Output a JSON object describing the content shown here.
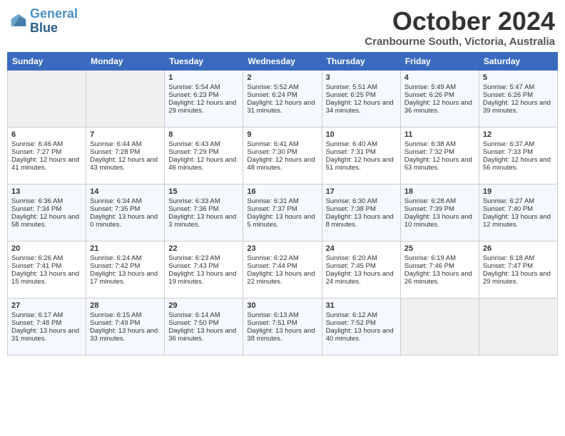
{
  "header": {
    "logo_line1": "General",
    "logo_line2": "Blue",
    "month_title": "October 2024",
    "subtitle": "Cranbourne South, Victoria, Australia"
  },
  "weekdays": [
    "Sunday",
    "Monday",
    "Tuesday",
    "Wednesday",
    "Thursday",
    "Friday",
    "Saturday"
  ],
  "weeks": [
    [
      {
        "day": "",
        "sunrise": "",
        "sunset": "",
        "daylight": ""
      },
      {
        "day": "",
        "sunrise": "",
        "sunset": "",
        "daylight": ""
      },
      {
        "day": "1",
        "sunrise": "Sunrise: 5:54 AM",
        "sunset": "Sunset: 6:23 PM",
        "daylight": "Daylight: 12 hours and 29 minutes."
      },
      {
        "day": "2",
        "sunrise": "Sunrise: 5:52 AM",
        "sunset": "Sunset: 6:24 PM",
        "daylight": "Daylight: 12 hours and 31 minutes."
      },
      {
        "day": "3",
        "sunrise": "Sunrise: 5:51 AM",
        "sunset": "Sunset: 6:25 PM",
        "daylight": "Daylight: 12 hours and 34 minutes."
      },
      {
        "day": "4",
        "sunrise": "Sunrise: 5:49 AM",
        "sunset": "Sunset: 6:26 PM",
        "daylight": "Daylight: 12 hours and 36 minutes."
      },
      {
        "day": "5",
        "sunrise": "Sunrise: 5:47 AM",
        "sunset": "Sunset: 6:26 PM",
        "daylight": "Daylight: 12 hours and 39 minutes."
      }
    ],
    [
      {
        "day": "6",
        "sunrise": "Sunrise: 6:46 AM",
        "sunset": "Sunset: 7:27 PM",
        "daylight": "Daylight: 12 hours and 41 minutes."
      },
      {
        "day": "7",
        "sunrise": "Sunrise: 6:44 AM",
        "sunset": "Sunset: 7:28 PM",
        "daylight": "Daylight: 12 hours and 43 minutes."
      },
      {
        "day": "8",
        "sunrise": "Sunrise: 6:43 AM",
        "sunset": "Sunset: 7:29 PM",
        "daylight": "Daylight: 12 hours and 46 minutes."
      },
      {
        "day": "9",
        "sunrise": "Sunrise: 6:41 AM",
        "sunset": "Sunset: 7:30 PM",
        "daylight": "Daylight: 12 hours and 48 minutes."
      },
      {
        "day": "10",
        "sunrise": "Sunrise: 6:40 AM",
        "sunset": "Sunset: 7:31 PM",
        "daylight": "Daylight: 12 hours and 51 minutes."
      },
      {
        "day": "11",
        "sunrise": "Sunrise: 6:38 AM",
        "sunset": "Sunset: 7:32 PM",
        "daylight": "Daylight: 12 hours and 53 minutes."
      },
      {
        "day": "12",
        "sunrise": "Sunrise: 6:37 AM",
        "sunset": "Sunset: 7:33 PM",
        "daylight": "Daylight: 12 hours and 56 minutes."
      }
    ],
    [
      {
        "day": "13",
        "sunrise": "Sunrise: 6:36 AM",
        "sunset": "Sunset: 7:34 PM",
        "daylight": "Daylight: 12 hours and 58 minutes."
      },
      {
        "day": "14",
        "sunrise": "Sunrise: 6:34 AM",
        "sunset": "Sunset: 7:35 PM",
        "daylight": "Daylight: 13 hours and 0 minutes."
      },
      {
        "day": "15",
        "sunrise": "Sunrise: 6:33 AM",
        "sunset": "Sunset: 7:36 PM",
        "daylight": "Daylight: 13 hours and 3 minutes."
      },
      {
        "day": "16",
        "sunrise": "Sunrise: 6:31 AM",
        "sunset": "Sunset: 7:37 PM",
        "daylight": "Daylight: 13 hours and 5 minutes."
      },
      {
        "day": "17",
        "sunrise": "Sunrise: 6:30 AM",
        "sunset": "Sunset: 7:38 PM",
        "daylight": "Daylight: 13 hours and 8 minutes."
      },
      {
        "day": "18",
        "sunrise": "Sunrise: 6:28 AM",
        "sunset": "Sunset: 7:39 PM",
        "daylight": "Daylight: 13 hours and 10 minutes."
      },
      {
        "day": "19",
        "sunrise": "Sunrise: 6:27 AM",
        "sunset": "Sunset: 7:40 PM",
        "daylight": "Daylight: 13 hours and 12 minutes."
      }
    ],
    [
      {
        "day": "20",
        "sunrise": "Sunrise: 6:26 AM",
        "sunset": "Sunset: 7:41 PM",
        "daylight": "Daylight: 13 hours and 15 minutes."
      },
      {
        "day": "21",
        "sunrise": "Sunrise: 6:24 AM",
        "sunset": "Sunset: 7:42 PM",
        "daylight": "Daylight: 13 hours and 17 minutes."
      },
      {
        "day": "22",
        "sunrise": "Sunrise: 6:23 AM",
        "sunset": "Sunset: 7:43 PM",
        "daylight": "Daylight: 13 hours and 19 minutes."
      },
      {
        "day": "23",
        "sunrise": "Sunrise: 6:22 AM",
        "sunset": "Sunset: 7:44 PM",
        "daylight": "Daylight: 13 hours and 22 minutes."
      },
      {
        "day": "24",
        "sunrise": "Sunrise: 6:20 AM",
        "sunset": "Sunset: 7:45 PM",
        "daylight": "Daylight: 13 hours and 24 minutes."
      },
      {
        "day": "25",
        "sunrise": "Sunrise: 6:19 AM",
        "sunset": "Sunset: 7:46 PM",
        "daylight": "Daylight: 13 hours and 26 minutes."
      },
      {
        "day": "26",
        "sunrise": "Sunrise: 6:18 AM",
        "sunset": "Sunset: 7:47 PM",
        "daylight": "Daylight: 13 hours and 29 minutes."
      }
    ],
    [
      {
        "day": "27",
        "sunrise": "Sunrise: 6:17 AM",
        "sunset": "Sunset: 7:48 PM",
        "daylight": "Daylight: 13 hours and 31 minutes."
      },
      {
        "day": "28",
        "sunrise": "Sunrise: 6:15 AM",
        "sunset": "Sunset: 7:49 PM",
        "daylight": "Daylight: 13 hours and 33 minutes."
      },
      {
        "day": "29",
        "sunrise": "Sunrise: 6:14 AM",
        "sunset": "Sunset: 7:50 PM",
        "daylight": "Daylight: 13 hours and 36 minutes."
      },
      {
        "day": "30",
        "sunrise": "Sunrise: 6:13 AM",
        "sunset": "Sunset: 7:51 PM",
        "daylight": "Daylight: 13 hours and 38 minutes."
      },
      {
        "day": "31",
        "sunrise": "Sunrise: 6:12 AM",
        "sunset": "Sunset: 7:52 PM",
        "daylight": "Daylight: 13 hours and 40 minutes."
      },
      {
        "day": "",
        "sunrise": "",
        "sunset": "",
        "daylight": ""
      },
      {
        "day": "",
        "sunrise": "",
        "sunset": "",
        "daylight": ""
      }
    ]
  ]
}
